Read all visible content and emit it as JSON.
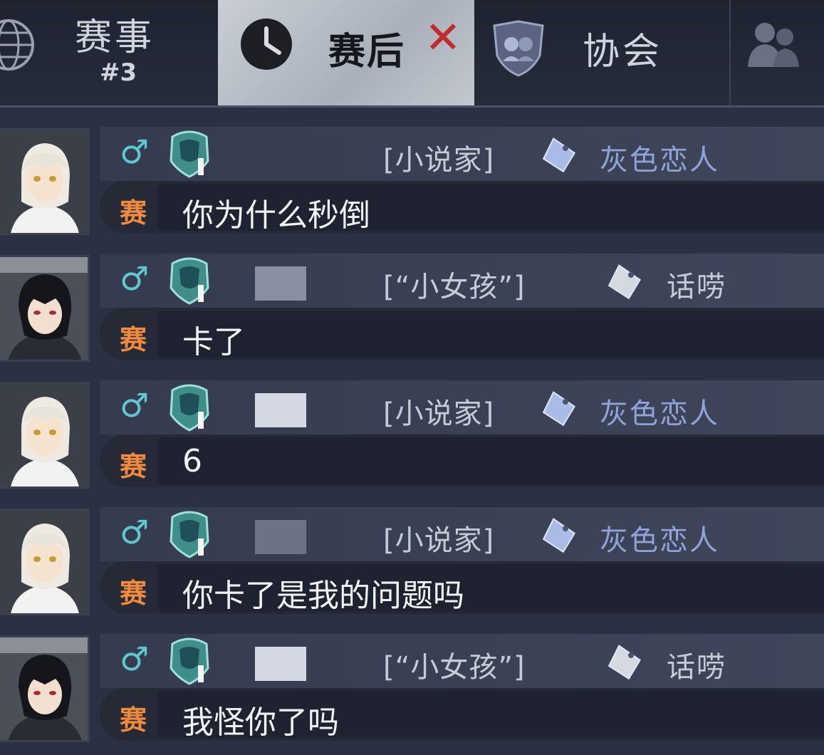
{
  "tabs": {
    "events": {
      "label": "赛事",
      "sub": "#3",
      "icon": "globe-icon"
    },
    "post_match": {
      "label": "赛后",
      "close": "✕",
      "icon": "clock-icon"
    },
    "association": {
      "label": "协会",
      "icon": "shield-icon"
    },
    "friends": {
      "icon": "people-icon"
    }
  },
  "messages": [
    {
      "avatar": "white-hair",
      "gender": "♂",
      "name_redacted": false,
      "title": "[小说家]",
      "tag": "灰色恋人",
      "tag_color": "#8fa3d8",
      "channel": "赛",
      "text": "你为什么秒倒"
    },
    {
      "avatar": "black-hair",
      "gender": "♂",
      "name_redacted": true,
      "title": "[“小女孩”]",
      "tag": "话唠",
      "tag_color": "#c6cbd6",
      "channel": "赛",
      "text": "卡了"
    },
    {
      "avatar": "white-hair",
      "gender": "♂",
      "name_redacted": true,
      "title": "[小说家]",
      "tag": "灰色恋人",
      "tag_color": "#8fa3d8",
      "channel": "赛",
      "text": "6"
    },
    {
      "avatar": "white-hair",
      "gender": "♂",
      "name_redacted": true,
      "title": "[小说家]",
      "tag": "灰色恋人",
      "tag_color": "#8fa3d8",
      "channel": "赛",
      "text": "你卡了是我的问题吗"
    },
    {
      "avatar": "black-hair",
      "gender": "♂",
      "name_redacted": true,
      "title": "[“小女孩”]",
      "tag": "话唠",
      "tag_color": "#c6cbd6",
      "channel": "赛",
      "text": "我怪你了吗"
    }
  ],
  "colors": {
    "accent_channel": "#f08a3c",
    "gender": "#5fc7cf",
    "close": "#c22b2b"
  }
}
